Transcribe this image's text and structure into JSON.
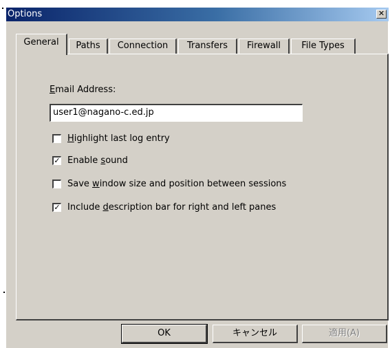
{
  "window": {
    "title": "Options",
    "close_glyph": "✕"
  },
  "tabs": [
    {
      "label": "General"
    },
    {
      "label": "Paths"
    },
    {
      "label": "Connection"
    },
    {
      "label": "Transfers"
    },
    {
      "label": "Firewall"
    },
    {
      "label": "File Types"
    }
  ],
  "general": {
    "email_label_prefix": "E",
    "email_label_rest": "mail Address:",
    "email_value": "user1@nagano-c.ed.jp",
    "options": [
      {
        "pre": "",
        "accel": "H",
        "post": "ighlight last log entry",
        "checked": false
      },
      {
        "pre": "Enable ",
        "accel": "s",
        "post": "ound",
        "checked": true
      },
      {
        "pre": "Save ",
        "accel": "w",
        "post": "indow size and position between sessions",
        "checked": false
      },
      {
        "pre": "Include ",
        "accel": "d",
        "post": "escription bar for right and left panes",
        "checked": true
      }
    ]
  },
  "buttons": {
    "ok": "OK",
    "cancel": "キャンセル",
    "apply": "適用(A)"
  },
  "check_glyph": "✓"
}
